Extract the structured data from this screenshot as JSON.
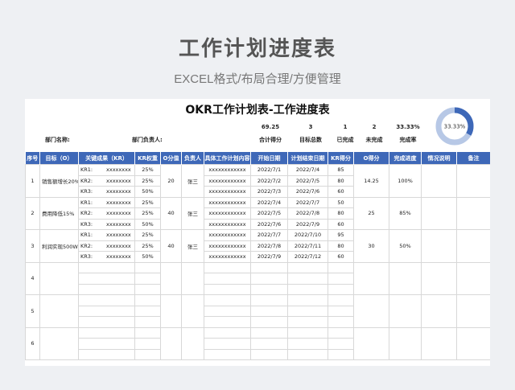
{
  "header": {
    "title": "工作计划进度表",
    "subtitle": "EXCEL格式/布局合理/方便管理"
  },
  "sheet": {
    "title": "OKR工作计划表-工作进度表",
    "dept_name_label": "部门名称:",
    "dept_head_label": "部门负责人:",
    "summary": [
      {
        "value": "69.25",
        "caption": "合计得分"
      },
      {
        "value": "3",
        "caption": "目标总数"
      },
      {
        "value": "1",
        "caption": "已完成"
      },
      {
        "value": "2",
        "caption": "未完成"
      },
      {
        "value": "33.33%",
        "caption": "完成率"
      }
    ],
    "donut": {
      "label": "33.33%",
      "fraction": 0.3333,
      "fill_color": "#3e68b8",
      "rest_color": "#b7c8e6"
    }
  },
  "table": {
    "headers": [
      "序号",
      "目标（O）",
      "关键成果（KR）",
      "KR权重",
      "O分值",
      "负责人",
      "具体工作计划内容",
      "开始日期",
      "计划结束日期",
      "KR得分",
      "O得分",
      "完成进度",
      "情况说明",
      "备注"
    ],
    "groups": [
      {
        "no": "1",
        "objective": "销售额增长20%",
        "o_value": "20",
        "owner": "张三",
        "o_score": "14.25",
        "progress": "100%",
        "krs": [
          {
            "kr": "KR1:",
            "kr_text": "xxxxxxxx",
            "weight": "25%",
            "plan": "xxxxxxxxxxxx",
            "start": "2022/7/1",
            "end": "2022/7/4",
            "score": "85"
          },
          {
            "kr": "KR2:",
            "kr_text": "xxxxxxxx",
            "weight": "25%",
            "plan": "xxxxxxxxxxxx",
            "start": "2022/7/2",
            "end": "2022/7/5",
            "score": "80"
          },
          {
            "kr": "KR3:",
            "kr_text": "xxxxxxxx",
            "weight": "50%",
            "plan": "xxxxxxxxxxxx",
            "start": "2022/7/3",
            "end": "2022/7/6",
            "score": "60"
          }
        ]
      },
      {
        "no": "2",
        "objective": "费用降低15%",
        "o_value": "40",
        "owner": "张三",
        "o_score": "25",
        "progress": "85%",
        "krs": [
          {
            "kr": "KR1:",
            "kr_text": "xxxxxxxx",
            "weight": "25%",
            "plan": "xxxxxxxxxxxx",
            "start": "2022/7/4",
            "end": "2022/7/7",
            "score": "50"
          },
          {
            "kr": "KR2:",
            "kr_text": "xxxxxxxx",
            "weight": "25%",
            "plan": "xxxxxxxxxxxx",
            "start": "2022/7/5",
            "end": "2022/7/8",
            "score": "80"
          },
          {
            "kr": "KR3:",
            "kr_text": "xxxxxxxx",
            "weight": "50%",
            "plan": "xxxxxxxxxxxx",
            "start": "2022/7/6",
            "end": "2022/7/9",
            "score": "60"
          }
        ]
      },
      {
        "no": "3",
        "objective": "利润实现500W",
        "o_value": "40",
        "owner": "张三",
        "o_score": "30",
        "progress": "50%",
        "krs": [
          {
            "kr": "KR1:",
            "kr_text": "xxxxxxxx",
            "weight": "25%",
            "plan": "xxxxxxxxxxxx",
            "start": "2022/7/7",
            "end": "2022/7/10",
            "score": "95"
          },
          {
            "kr": "KR2:",
            "kr_text": "xxxxxxxx",
            "weight": "25%",
            "plan": "xxxxxxxxxxxx",
            "start": "2022/7/8",
            "end": "2022/7/11",
            "score": "80"
          },
          {
            "kr": "KR3:",
            "kr_text": "xxxxxxxx",
            "weight": "50%",
            "plan": "xxxxxxxxxxxx",
            "start": "2022/7/9",
            "end": "2022/7/12",
            "score": "60"
          }
        ]
      },
      {
        "no": "4",
        "objective": "",
        "o_value": "",
        "owner": "",
        "o_score": "",
        "progress": "",
        "krs": [
          {},
          {},
          {}
        ]
      },
      {
        "no": "5",
        "objective": "",
        "o_value": "",
        "owner": "",
        "o_score": "",
        "progress": "",
        "krs": [
          {},
          {},
          {}
        ]
      },
      {
        "no": "6",
        "objective": "",
        "o_value": "",
        "owner": "",
        "o_score": "",
        "progress": "",
        "krs": [
          {},
          {},
          {}
        ]
      }
    ]
  }
}
